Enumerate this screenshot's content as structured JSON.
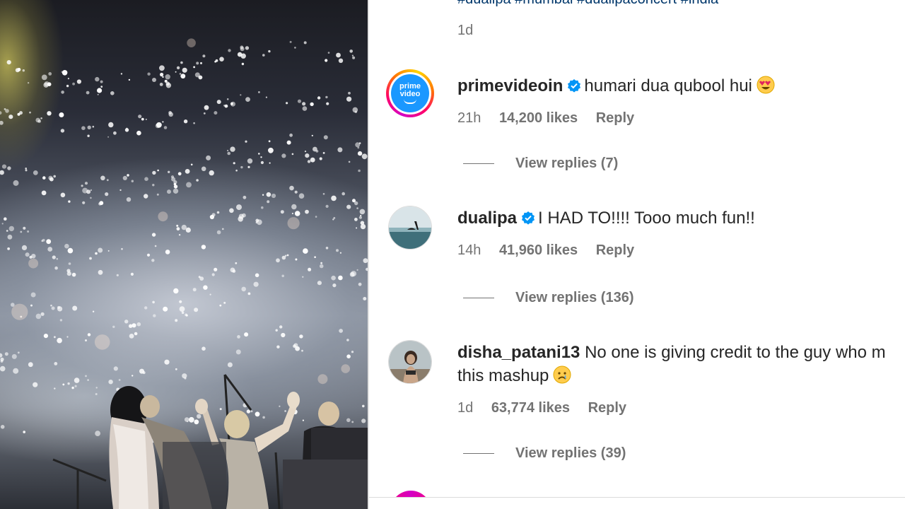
{
  "caption": {
    "hashtags": "#dualipa #mumbai #dualipaconcert #india",
    "time": "1d"
  },
  "comments": [
    {
      "username": "primevideoin",
      "verified": true,
      "text": "humari dua qubool hui",
      "emoji": "heart-eyes-emoji",
      "avatar_text_1": "prime",
      "avatar_text_2": "video",
      "time": "21h",
      "likes": "14,200 likes",
      "reply_label": "Reply",
      "view_replies": "View replies (7)"
    },
    {
      "username": "dualipa",
      "verified": true,
      "text": "I HAD TO!!!! Tooo much fun!!",
      "time": "14h",
      "likes": "41,960 likes",
      "reply_label": "Reply",
      "view_replies": "View replies (136)"
    },
    {
      "username": "disha_patani13",
      "verified": false,
      "text_line1": "No one is giving credit to the guy who m",
      "text_line2": "this mashup",
      "emoji": "crying-emoji",
      "time": "1d",
      "likes": "63,774 likes",
      "reply_label": "Reply",
      "view_replies": "View replies (39)"
    }
  ],
  "colors": {
    "link": "#00376b",
    "secondary_text": "#737373",
    "verified_badge": "#0095f6",
    "prime_blue": "#1a98ff"
  }
}
